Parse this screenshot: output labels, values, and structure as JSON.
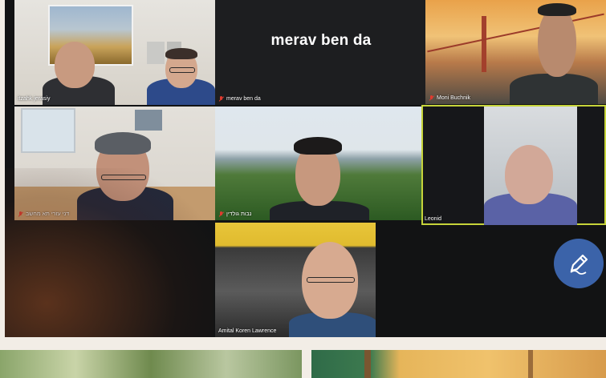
{
  "meeting": {
    "participants": [
      {
        "name": "itzahk jerasiy",
        "muted": false
      },
      {
        "name": "merav ben da",
        "muted": true,
        "placeholder_text": "merav ben da"
      },
      {
        "name": "Moni Buchnik",
        "muted": true
      },
      {
        "name": "דני עזרי תא מחשב",
        "muted": true
      },
      {
        "name": "נבות גולדין",
        "muted": true
      },
      {
        "name": "Leonid",
        "muted": false,
        "active_speaker": true
      },
      {
        "name": "Amital Koren Lawrence",
        "muted": false
      }
    ]
  },
  "toolbar": {
    "annotate_icon": "pencil-icon"
  },
  "colors": {
    "screen_bg": "#121314",
    "active_border": "#c6d43a",
    "annotate_button": "#3b63a9",
    "mute_indicator": "#e03b2f"
  }
}
